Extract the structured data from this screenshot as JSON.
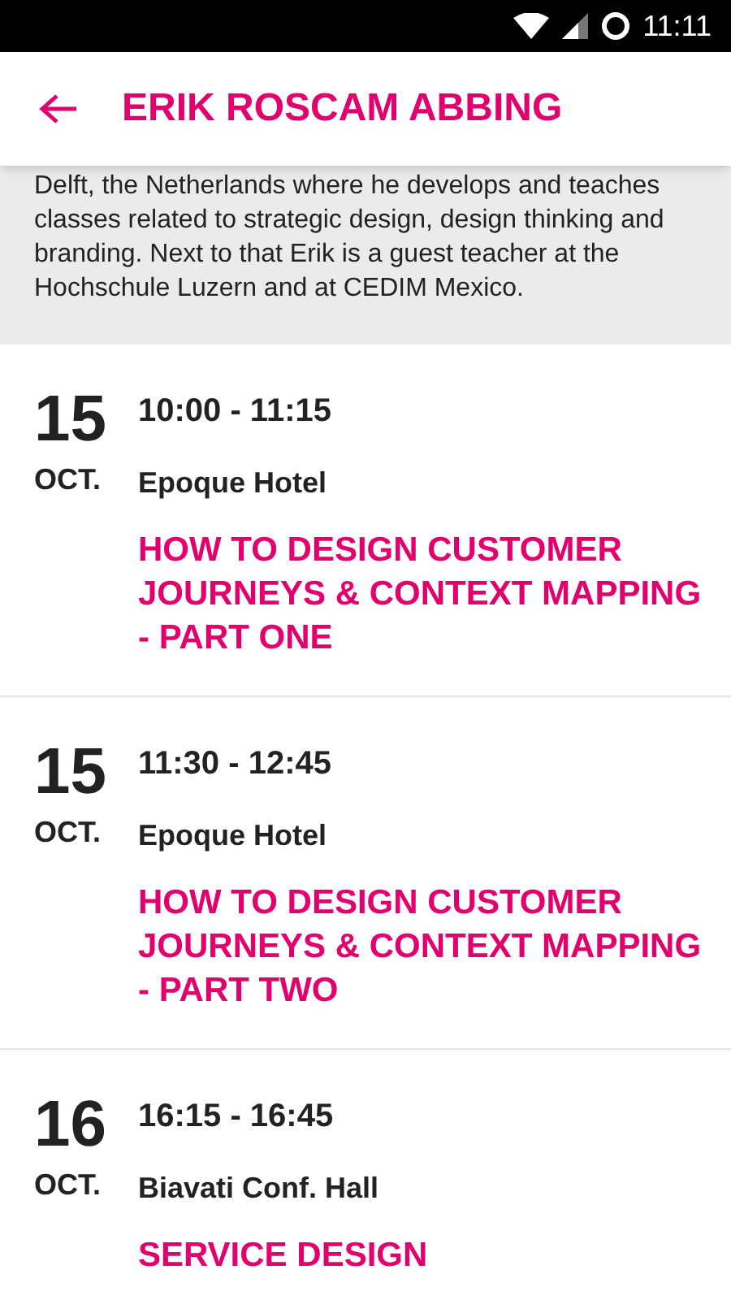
{
  "status_bar": {
    "time": "11:11"
  },
  "header": {
    "title": "ERIK ROSCAM ABBING"
  },
  "bio": {
    "text": "Delft, the Netherlands where he develops and teaches classes related to strategic design, design thinking and branding. Next to that Erik is a guest teacher at the Hochschule Luzern and at CEDIM Mexico."
  },
  "sessions": [
    {
      "day": "15",
      "month": "OCT.",
      "time": "10:00 - 11:15",
      "location": "Epoque Hotel",
      "title": "HOW TO DESIGN CUSTOMER JOURNEYS & CONTEXT MAPPING - PART ONE"
    },
    {
      "day": "15",
      "month": "OCT.",
      "time": "11:30 - 12:45",
      "location": "Epoque Hotel",
      "title": "HOW TO DESIGN CUSTOMER JOURNEYS & CONTEXT MAPPING - PART TWO"
    },
    {
      "day": "16",
      "month": "OCT.",
      "time": "16:15 - 16:45",
      "location": "Biavati Conf. Hall",
      "title": "SERVICE DESIGN"
    }
  ]
}
